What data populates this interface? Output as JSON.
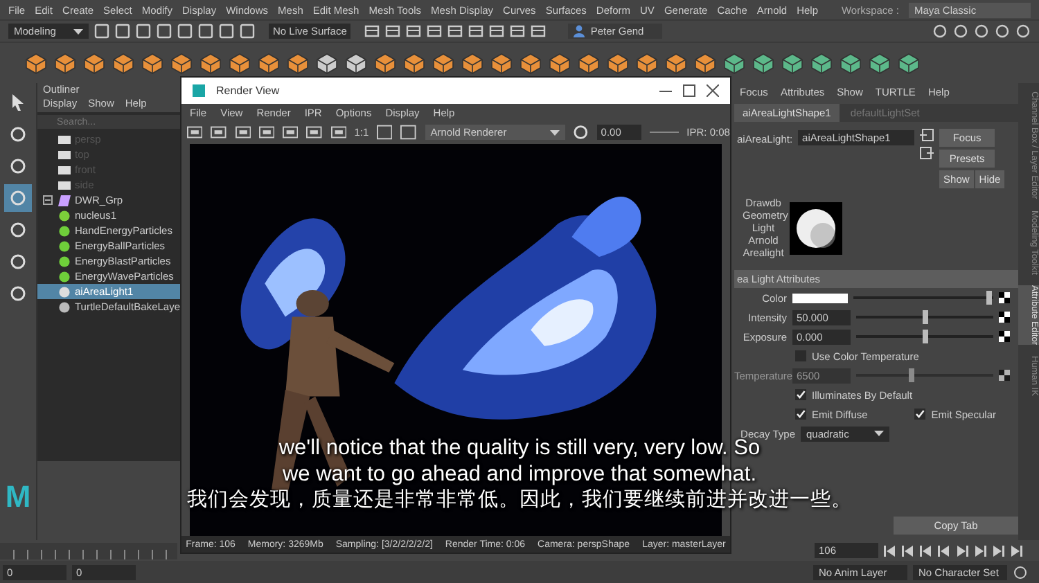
{
  "menubar": {
    "items": [
      "File",
      "Edit",
      "Create",
      "Select",
      "Modify",
      "Display",
      "Windows",
      "Mesh",
      "Edit Mesh",
      "Mesh Tools",
      "Mesh Display",
      "Curves",
      "Surfaces",
      "Deform",
      "UV",
      "Generate",
      "Cache",
      "Arnold",
      "Help"
    ],
    "workspace_label": "Workspace :",
    "workspace": "Maya Classic"
  },
  "status_line": {
    "mode": "Modeling",
    "live_surface": "No Live Surface",
    "user": "Peter Gend"
  },
  "toolbox": {
    "tools": [
      {
        "selected": false
      },
      {
        "selected": false
      },
      {
        "selected": false
      },
      {
        "selected": true
      },
      {
        "selected": false
      },
      {
        "selected": false
      },
      {
        "selected": false
      }
    ],
    "logo": "M"
  },
  "outliner": {
    "title": "Outliner",
    "menu": [
      "Display",
      "Show",
      "Help"
    ],
    "search_placeholder": "Search...",
    "items": [
      {
        "label": "persp",
        "kind": "camera",
        "selected": false,
        "dimmed": true
      },
      {
        "label": "top",
        "kind": "camera",
        "selected": false,
        "dimmed": true
      },
      {
        "label": "front",
        "kind": "camera",
        "selected": false,
        "dimmed": true
      },
      {
        "label": "side",
        "kind": "camera",
        "selected": false,
        "dimmed": true
      },
      {
        "label": "DWR_Grp",
        "kind": "group",
        "selected": false,
        "dimmed": false,
        "expanded": true
      },
      {
        "label": "nucleus1",
        "kind": "nucleus",
        "selected": false,
        "dimmed": false
      },
      {
        "label": "HandEnergyParticles",
        "kind": "particles",
        "selected": false,
        "dimmed": false
      },
      {
        "label": "EnergyBallParticles",
        "kind": "particles",
        "selected": false,
        "dimmed": false
      },
      {
        "label": "EnergyBlastParticles",
        "kind": "particles",
        "selected": false,
        "dimmed": false
      },
      {
        "label": "EnergyWaveParticles",
        "kind": "particles",
        "selected": false,
        "dimmed": false
      },
      {
        "label": "aiAreaLight1",
        "kind": "light",
        "selected": true,
        "dimmed": false
      },
      {
        "label": "TurtleDefaultBakeLaye",
        "kind": "layer",
        "selected": false,
        "dimmed": false
      }
    ]
  },
  "render_view": {
    "title": "Render View",
    "menu": [
      "File",
      "View",
      "Render",
      "IPR",
      "Options",
      "Display",
      "Help"
    ],
    "ratio": "1:1",
    "renderer": "Arnold Renderer",
    "exposure": "0.00",
    "ipr": "IPR: 0:08",
    "status": [
      "Frame: 106",
      "Memory: 3269Mb",
      "Sampling: [3/2/2/2/2/2]",
      "Render Time: 0:06",
      "Camera: perspShape",
      "Layer: masterLayer"
    ]
  },
  "attribute_editor": {
    "menu": [
      "Focus",
      "Attributes",
      "Show",
      "TURTLE",
      "Help"
    ],
    "tabs": [
      {
        "label": "aiAreaLightShape1",
        "selected": true
      },
      {
        "label": "defaultLightSet",
        "selected": false
      }
    ],
    "node_label": "aiAreaLight:",
    "node_name": "aiAreaLightShape1",
    "buttons": [
      "Focus",
      "Presets",
      "Show",
      "Hide"
    ],
    "swatch_label": "Drawdb Geometry Light Arnold Arealight",
    "section": "ea Light Attributes",
    "rows": [
      {
        "kind": "color",
        "label": "Color",
        "level": 0.97
      },
      {
        "kind": "slider",
        "label": "Intensity",
        "value": "50.000",
        "level": 0.5,
        "disabled": false
      },
      {
        "kind": "slider",
        "label": "Exposure",
        "value": "0.000",
        "level": 0.5,
        "disabled": false
      },
      {
        "kind": "checkboxes",
        "boxes": [
          {
            "label": "Use Color Temperature",
            "checked": false
          }
        ]
      },
      {
        "kind": "slider",
        "label": "Temperature",
        "value": "6500",
        "level": 0.4,
        "disabled": true
      },
      {
        "kind": "checkboxes",
        "boxes": [
          {
            "label": "Illuminates By Default",
            "checked": true
          }
        ]
      },
      {
        "kind": "checkboxes",
        "boxes": [
          {
            "label": "Emit Diffuse",
            "checked": true
          },
          {
            "label": "Emit Specular",
            "checked": true
          }
        ]
      },
      {
        "kind": "dropdown",
        "label": "Decay Type",
        "value": "quadratic"
      }
    ],
    "copy_button": "Copy Tab"
  },
  "side_tabs": [
    {
      "label": "Channel Box / Layer Editor",
      "selected": false
    },
    {
      "label": "Modeling Toolkit",
      "selected": false
    },
    {
      "label": "Attribute Editor",
      "selected": true
    },
    {
      "label": "Human IK",
      "selected": false
    }
  ],
  "timeline": {
    "current_frame": "106",
    "range_start": "0",
    "range_inner": "0",
    "anim_layer": "No Anim Layer",
    "character_set": "No Character Set"
  },
  "subtitles": [
    "we'll notice that the quality is still very, very low. So",
    "we want to go ahead and improve that somewhat.",
    "我们会发现，质量还是非常非常低。因此，我们要继续前进并改进一些。"
  ]
}
